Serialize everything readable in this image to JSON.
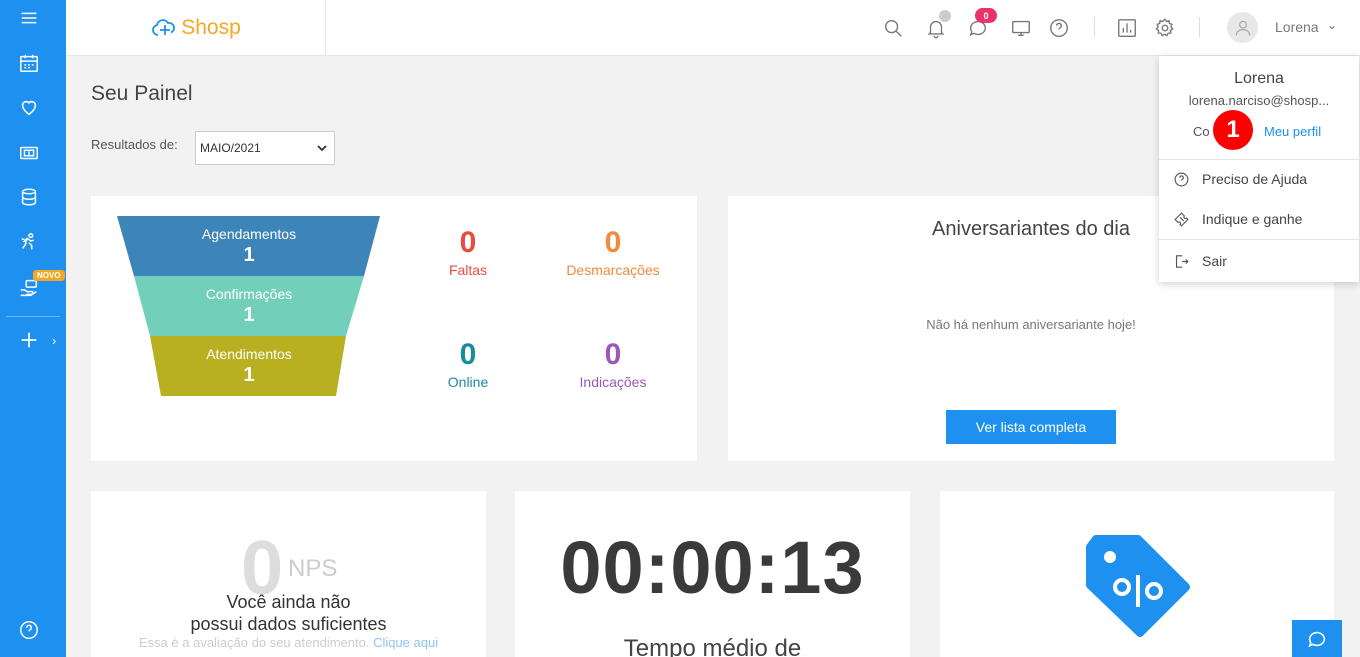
{
  "app": {
    "name": "Shosp",
    "accent": "#1e90f0"
  },
  "sidebar": {
    "novo_badge": "NOVO",
    "items": [
      {
        "icon": "menu-icon"
      },
      {
        "icon": "calendar-icon"
      },
      {
        "icon": "heart-icon"
      },
      {
        "icon": "money-icon"
      },
      {
        "icon": "database-icon"
      },
      {
        "icon": "running-icon"
      },
      {
        "icon": "hand-money-icon"
      },
      {
        "icon": "plus-icon"
      },
      {
        "icon": "help-icon"
      }
    ]
  },
  "header": {
    "messages_badge": "0",
    "user": {
      "name": "Lorena"
    }
  },
  "page": {
    "title": "Seu Painel",
    "filter_label": "Resultados de:",
    "filter_value": "MAIO/2021"
  },
  "funnel": {
    "stages": [
      {
        "label": "Agendamentos",
        "value": "1",
        "color": "#3d85b8"
      },
      {
        "label": "Confirmações",
        "value": "1",
        "color": "#72d0ba"
      },
      {
        "label": "Atendimentos",
        "value": "1",
        "color": "#b8b020"
      }
    ]
  },
  "stats": [
    {
      "value": "0",
      "label": "Faltas",
      "color": "#e84c3d"
    },
    {
      "value": "0",
      "label": "Desmarcações",
      "color": "#f08a3c"
    },
    {
      "value": "0",
      "label": "Online",
      "color": "#1a8aa0"
    },
    {
      "value": "0",
      "label": "Indicações",
      "color": "#9b59b6"
    }
  ],
  "aniversariantes": {
    "title": "Aniversariantes do dia",
    "empty": "Não há nenhum aniversariante hoje!",
    "button": "Ver lista completa"
  },
  "nps": {
    "value": "0",
    "label": "NPS",
    "message_line1": "Você ainda não",
    "message_line2": "possui dados suficientes",
    "sub_text": "Essa é a avaliação do seu atendimento.",
    "sub_link": "Clique aqui"
  },
  "timer": {
    "value": "00:00:13",
    "label": "Tempo médio de"
  },
  "dropdown": {
    "name": "Lorena",
    "email": "lorena.narciso@shosp...",
    "conta_label": "Co",
    "perfil_label": "Meu perfil",
    "marker": "1",
    "items": [
      {
        "label": "Preciso de Ajuda",
        "icon": "help-circle-icon"
      },
      {
        "label": "Indique e ganhe",
        "icon": "ticket-icon"
      },
      {
        "label": "Sair",
        "icon": "logout-icon"
      }
    ]
  }
}
